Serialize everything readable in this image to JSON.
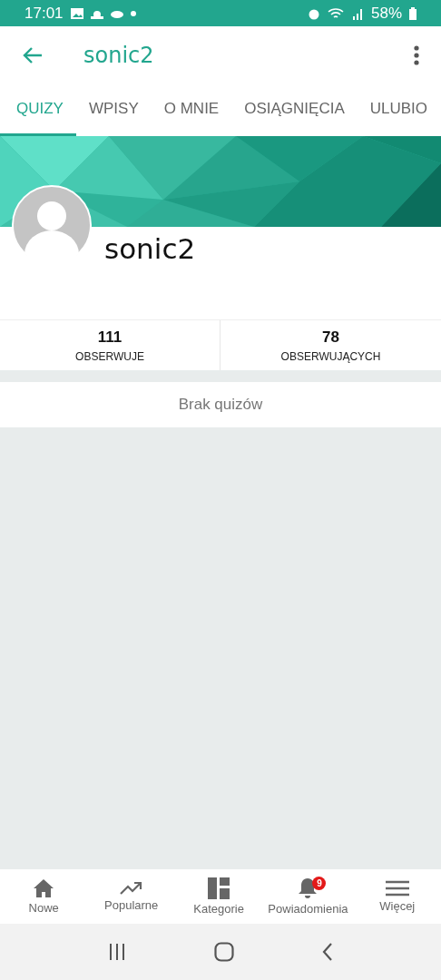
{
  "status_bar": {
    "time": "17:01",
    "battery": "58%"
  },
  "app_bar": {
    "title": "sonic2"
  },
  "tabs": [
    {
      "label": "QUIZY",
      "selected": true
    },
    {
      "label": "WPISY",
      "selected": false
    },
    {
      "label": "O MNIE",
      "selected": false
    },
    {
      "label": "OSIĄGNIĘCIA",
      "selected": false
    },
    {
      "label": "ULUBIO",
      "selected": false
    }
  ],
  "profile": {
    "name": "sonic2"
  },
  "stats": [
    {
      "value": "111",
      "label": "OBSERWUJE"
    },
    {
      "value": "78",
      "label": "OBSERWUJĄCYCH"
    }
  ],
  "empty_message": "Brak quizów",
  "bottom_nav": [
    {
      "kind": "home",
      "label": "Nowe"
    },
    {
      "kind": "trending",
      "label": "Popularne"
    },
    {
      "kind": "grid",
      "label": "Kategorie"
    },
    {
      "kind": "bell",
      "label": "Powiadomienia",
      "badge": "9"
    },
    {
      "kind": "menu",
      "label": "Więcej"
    }
  ]
}
